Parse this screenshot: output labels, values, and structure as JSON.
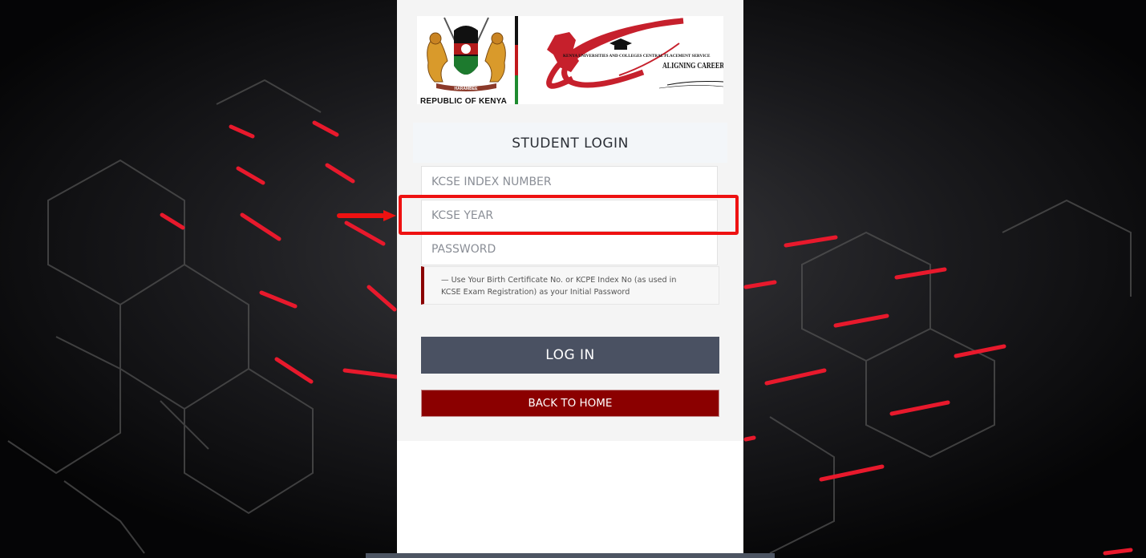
{
  "colors": {
    "accent_red": "#8b0000",
    "login_button": "#4a5162",
    "annotation": "#ee1111"
  },
  "branding": {
    "coat_of_arms_caption": "REPUBLIC OF KENYA",
    "motto": "HARAMBEE",
    "kuccps_title": "KENYA UNIVERSITIES AND COLLEGES CENTRAL PLACEMENT SERVICE",
    "kuccps_tagline": "ALIGNING CAREERS"
  },
  "login": {
    "heading": "STUDENT LOGIN",
    "index_placeholder": "KCSE INDEX NUMBER",
    "year_placeholder": "KCSE YEAR",
    "password_placeholder": "PASSWORD",
    "hint": "— Use Your Birth Certificate No. or KCPE Index No (as used in KCSE Exam Registration) as your Initial Password",
    "login_button": "LOG IN",
    "home_button": "BACK TO HOME"
  },
  "icons": {
    "annotation_arrow": "arrow-right-icon",
    "annotation_box": "highlight-box"
  }
}
